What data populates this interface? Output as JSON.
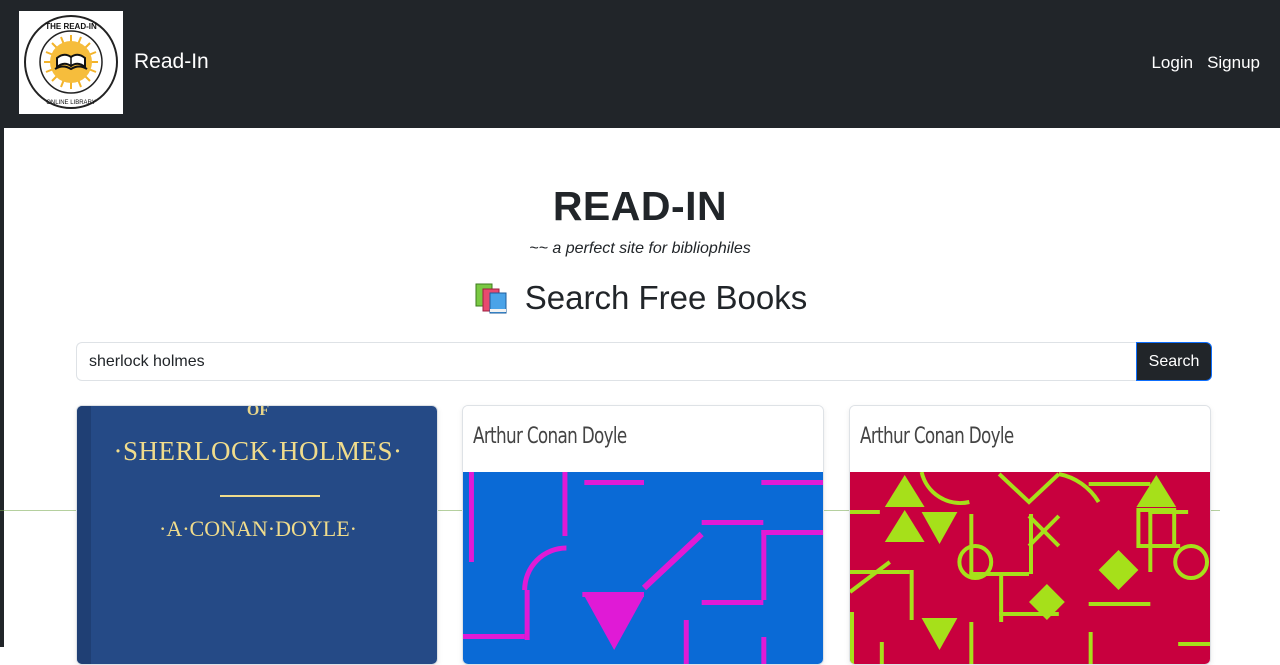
{
  "nav": {
    "logo_top_text": "THE READ-IN",
    "logo_bottom_text": "ONLINE LIBRARY",
    "brand": "Read-In",
    "links": [
      {
        "label": "Login"
      },
      {
        "label": "Signup"
      }
    ]
  },
  "hero": {
    "title": "READ-IN",
    "tagline": "~~ a perfect site for bibliophiles",
    "search_heading": "Search Free Books"
  },
  "search": {
    "value": "sherlock holmes",
    "button_label": "Search"
  },
  "results": [
    {
      "cover_text_top": "OF",
      "cover_title": "·SHERLOCK·HOLMES·",
      "cover_author": "·A·CONAN·DOYLE·"
    },
    {
      "author": "Arthur Conan Doyle"
    },
    {
      "author": "Arthur Conan Doyle"
    }
  ],
  "colors": {
    "navbar": "#212529",
    "cover_blue": "#254a86",
    "cover_gold": "#f0dc8c",
    "art2_bg": "#0a6ad6",
    "art2_fg": "#e01ad6",
    "art3_bg": "#c8003e",
    "art3_fg": "#a6e01a"
  },
  "icons": {
    "books": "books-icon",
    "logo": "open-book-logo"
  }
}
